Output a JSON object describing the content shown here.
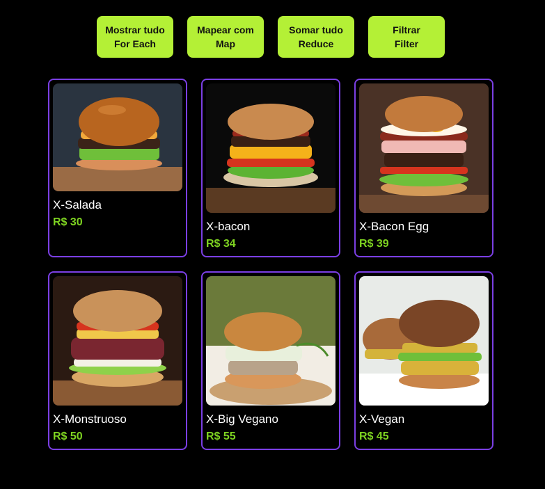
{
  "buttons": [
    {
      "line1": "Mostrar tudo",
      "line2": "For Each"
    },
    {
      "line1": "Mapear com",
      "line2": "Map"
    },
    {
      "line1": "Somar tudo",
      "line2": "Reduce"
    },
    {
      "line1": "Filtrar",
      "line2": "Filter"
    }
  ],
  "products": [
    {
      "name": "X-Salada",
      "price": "R$ 30",
      "icon": "burger-salada-photo"
    },
    {
      "name": "X-bacon",
      "price": "R$ 34",
      "icon": "burger-bacon-photo"
    },
    {
      "name": "X-Bacon Egg",
      "price": "R$ 39",
      "icon": "burger-bacon-egg-photo"
    },
    {
      "name": "X-Monstruoso",
      "price": "R$ 50",
      "icon": "burger-monstruoso-photo"
    },
    {
      "name": "X-Big Vegano",
      "price": "R$ 55",
      "icon": "burger-big-vegano-photo"
    },
    {
      "name": "X-Vegan",
      "price": "R$ 45",
      "icon": "burger-vegan-photo"
    }
  ],
  "colors": {
    "accent": "#b4f036",
    "border": "#7b3fe4",
    "price": "#7ed321",
    "background": "#000000"
  }
}
